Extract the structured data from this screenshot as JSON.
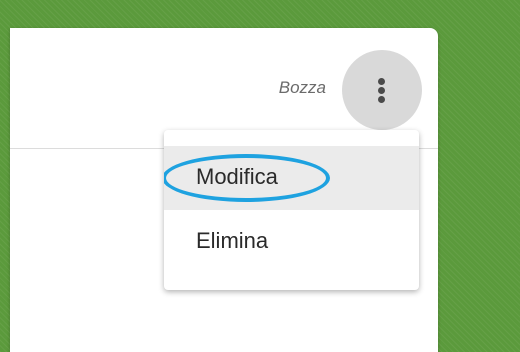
{
  "card": {
    "status": "Bozza",
    "more_button": {
      "icon": "more-vert-icon"
    }
  },
  "menu": {
    "items": [
      {
        "label": "Modifica",
        "highlighted": true
      },
      {
        "label": "Elimina",
        "highlighted": false
      }
    ]
  },
  "colors": {
    "background": "#5b9a3c",
    "highlight_ring": "#1ea2e0"
  }
}
